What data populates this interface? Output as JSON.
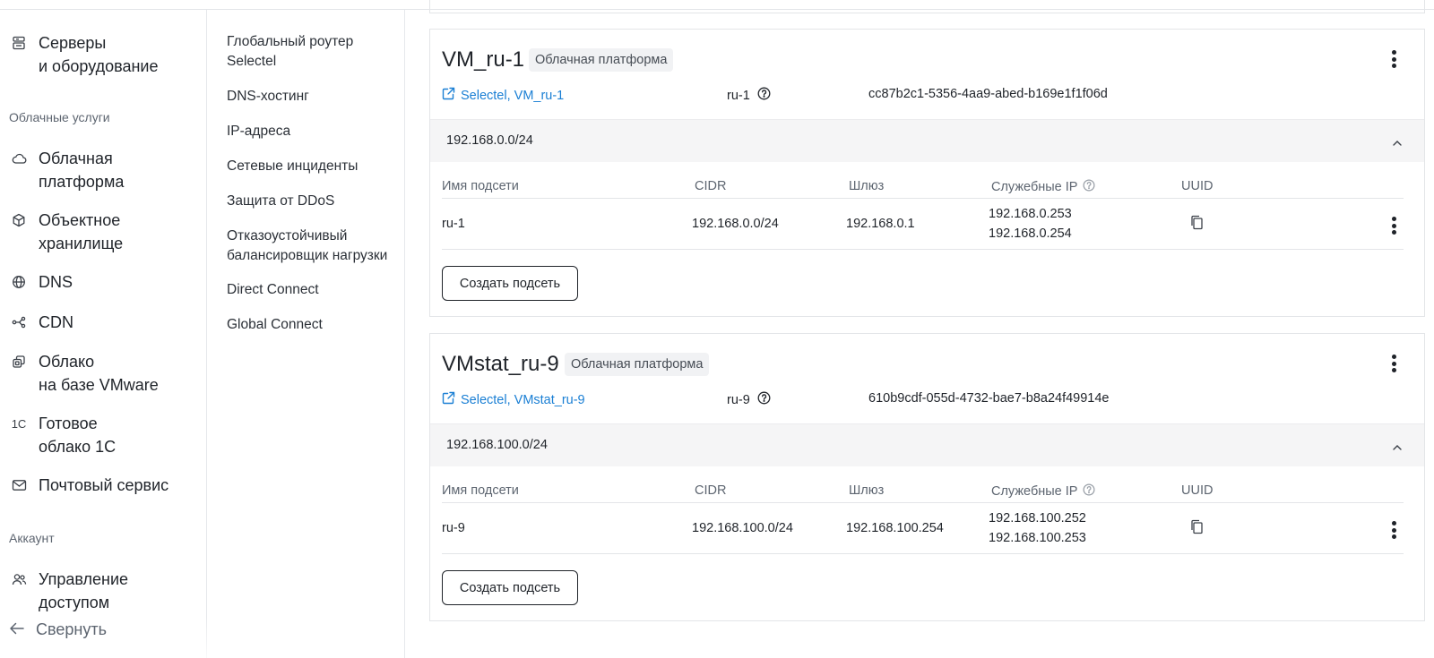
{
  "sidebar": {
    "items_top": [
      {
        "icon": "server-icon",
        "label": "Серверы\nи оборудование"
      }
    ],
    "section_cloud": "Облачные услуги",
    "items_cloud": [
      {
        "icon": "cloud-icon",
        "label": "Облачная\nплатформа"
      },
      {
        "icon": "cube-icon",
        "label": "Объектное\nхранилище"
      },
      {
        "icon": "globe-icon",
        "label": "DNS"
      },
      {
        "icon": "cdn-icon",
        "label": "CDN"
      },
      {
        "icon": "vmware-icon",
        "label": "Облако\nна базе VMware"
      },
      {
        "icon": "1c-icon",
        "label": "Готовое\nоблако 1С"
      },
      {
        "icon": "mail-icon",
        "label": "Почтовый сервис"
      }
    ],
    "section_account": "Аккаунт",
    "items_account": [
      {
        "icon": "users-icon",
        "label": "Управление\nдоступом"
      }
    ],
    "collapse_label": "Свернуть",
    "icon_1c_text": "1С"
  },
  "submenu": {
    "items": [
      "Глобальный роутер\nSelectel",
      "DNS-хостинг",
      "IP-адреса",
      "Сетевые инциденты",
      "Защита от DDoS",
      "Отказоустойчивый\nбалансировщик нагрузки",
      "Direct Connect",
      "Global Connect"
    ]
  },
  "table_headers": {
    "name": "Имя подсети",
    "cidr": "CIDR",
    "gateway": "Шлюз",
    "service_ip": "Служебные IP",
    "uuid": "UUID"
  },
  "cards": [
    {
      "title": "VM_ru-1",
      "badge": "Облачная платформа",
      "link": "Selectel, VM_ru-1",
      "region": "ru-1",
      "uuid": "cc87b2c1-5356-4aa9-abed-b169e1f1f06d",
      "network": "192.168.0.0/24",
      "subnet": {
        "name": "ru-1",
        "cidr": "192.168.0.0/24",
        "gateway": "192.168.0.1",
        "service_ip_1": "192.168.0.253",
        "service_ip_2": "192.168.0.254"
      },
      "button": "Создать подсеть"
    },
    {
      "title": "VMstat_ru-9",
      "badge": "Облачная платформа",
      "link": "Selectel, VMstat_ru-9",
      "region": "ru-9",
      "uuid": "610b9cdf-055d-4732-bae7-b8a24f49914e",
      "network": "192.168.100.0/24",
      "subnet": {
        "name": "ru-9",
        "cidr": "192.168.100.0/24",
        "gateway": "192.168.100.254",
        "service_ip_1": "192.168.100.252",
        "service_ip_2": "192.168.100.253"
      },
      "button": "Создать подсеть"
    }
  ],
  "colors": {
    "link": "#1a7fd4",
    "text": "#1f2329",
    "muted": "#5d6570",
    "border": "#e3e5e8"
  }
}
